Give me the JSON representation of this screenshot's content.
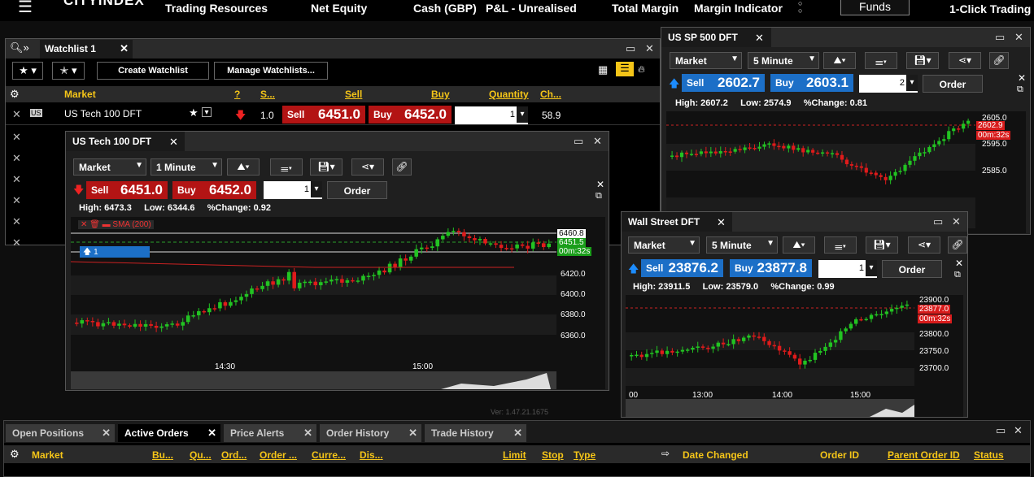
{
  "topbar": {
    "logo": "CITYINDEX",
    "items": [
      "Trading Resources",
      "Net Equity",
      "Cash (GBP)",
      "P&L - Unrealised",
      "Total Margin",
      "Margin Indicator"
    ],
    "funds_label": "Funds",
    "one_click": "1-Click Trading"
  },
  "watchlist": {
    "title": "Watchlist 1",
    "create_label": "Create Watchlist",
    "manage_label": "Manage Watchlists...",
    "columns": [
      "Market",
      "?",
      "S...",
      "Sell",
      "Buy",
      "Quantity",
      "Ch..."
    ],
    "rows": [
      {
        "market": "US Tech 100 DFT",
        "spread": "1.0",
        "sell": "6451.0",
        "buy": "6452.0",
        "qty": "1",
        "change": "58.9"
      }
    ]
  },
  "us100": {
    "title": "US Tech 100 DFT",
    "order_type": "Market",
    "interval": "1 Minute",
    "sell_label": "Sell",
    "sell": "6451.0",
    "buy_label": "Buy",
    "buy": "6452.0",
    "qty": "1",
    "order_label": "Order",
    "high_label": "High:",
    "high": "6473.3",
    "low_label": "Low:",
    "low": "6344.6",
    "chg_label": "%Change:",
    "chg": "0.92",
    "sma_label": "SMA (200)",
    "position_label": "1",
    "price_tags": [
      "6460.8",
      "6451.5",
      "00m:32s"
    ],
    "y_ticks": [
      "6420.0",
      "6400.0",
      "6380.0",
      "6360.0"
    ],
    "x_ticks": [
      "14:30",
      "15:00"
    ],
    "version": "Ver: 1.47.21.1675"
  },
  "sp500": {
    "title": "US SP 500 DFT",
    "order_type": "Market",
    "interval": "5 Minute",
    "sell_label": "Sell",
    "sell": "2602.7",
    "buy_label": "Buy",
    "buy": "2603.1",
    "qty": "2",
    "order_label": "Order",
    "high_label": "High:",
    "high": "2607.2",
    "low_label": "Low:",
    "low": "2574.9",
    "chg_label": "%Change:",
    "chg": "0.81",
    "price_tags": [
      "2602.9",
      "00m:32s"
    ],
    "y_ticks": [
      "2605.0",
      "2595.0",
      "2585.0"
    ]
  },
  "wallst": {
    "title": "Wall Street DFT",
    "order_type": "Market",
    "interval": "5 Minute",
    "sell_label": "Sell",
    "sell": "23876.2",
    "buy_label": "Buy",
    "buy": "23877.8",
    "qty": "1",
    "order_label": "Order",
    "high_label": "High:",
    "high": "23911.5",
    "low_label": "Low:",
    "low": "23579.0",
    "chg_label": "%Change:",
    "chg": "0.99",
    "price_tags": [
      "23877.0",
      "00m:32s"
    ],
    "y_ticks": [
      "23900.0",
      "23800.0",
      "23750.0",
      "23700.0"
    ],
    "x_ticks": [
      "00",
      "13:00",
      "14:00",
      "15:00"
    ]
  },
  "bottom": {
    "tabs": [
      "Open Positions",
      "Active Orders",
      "Price Alerts",
      "Order History",
      "Trade History"
    ],
    "active_tab": "Active Orders",
    "columns": [
      "Market",
      "Bu...",
      "Qu...",
      "Ord...",
      "Order ...",
      "Curre...",
      "Dis...",
      "Limit",
      "Stop",
      "Type",
      "Date Changed",
      "Order ID",
      "Parent Order ID",
      "Status"
    ]
  }
}
